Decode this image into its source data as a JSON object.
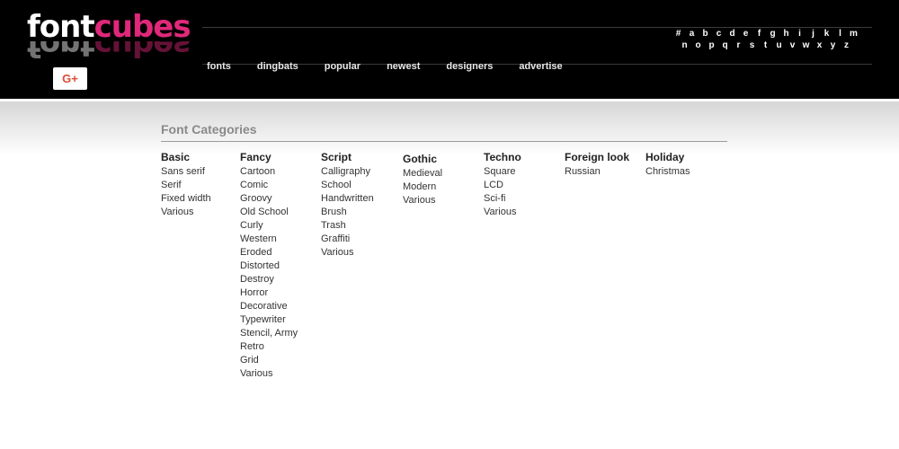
{
  "logo": {
    "part1": "font",
    "part2": "cubes"
  },
  "gplus_label": "G+",
  "nav": [
    "fonts",
    "dingbats",
    "popular",
    "newest",
    "designers",
    "advertise"
  ],
  "alphabet": {
    "row1": [
      "#",
      "a",
      "b",
      "c",
      "d",
      "e",
      "f",
      "g",
      "h",
      "i",
      "j",
      "k",
      "l",
      "m"
    ],
    "row2": [
      "n",
      "o",
      "p",
      "q",
      "r",
      "s",
      "t",
      "u",
      "v",
      "w",
      "x",
      "y",
      "z"
    ]
  },
  "section_title": "Font Categories",
  "categories": [
    {
      "title": "Basic",
      "items": [
        "Sans serif",
        "Serif",
        "Fixed width",
        "Various"
      ]
    },
    {
      "title": "Fancy",
      "items": [
        "Cartoon",
        "Comic",
        "Groovy",
        "Old School",
        "Curly",
        "Western",
        "Eroded",
        "Distorted",
        "Destroy",
        "Horror",
        "Decorative",
        "Typewriter",
        "Stencil, Army",
        "Retro",
        "Grid",
        "Various"
      ]
    },
    {
      "title": "Script",
      "items": [
        "Calligraphy",
        "School",
        "Handwritten",
        "Brush",
        "Trash",
        "Graffiti",
        "Various"
      ]
    },
    {
      "title": "Gothic",
      "items": [
        "Medieval",
        "Modern",
        "Various"
      ]
    },
    {
      "title": "Techno",
      "items": [
        "Square",
        "LCD",
        "Sci-fi",
        "Various"
      ]
    },
    {
      "title": "Foreign look",
      "items": [
        "Russian"
      ]
    },
    {
      "title": "Holiday",
      "items": [
        "Christmas"
      ]
    }
  ],
  "colors": {
    "header_bg": "#000000",
    "brand_pink": "#e0287a",
    "gplus_red": "#dd4b39"
  }
}
